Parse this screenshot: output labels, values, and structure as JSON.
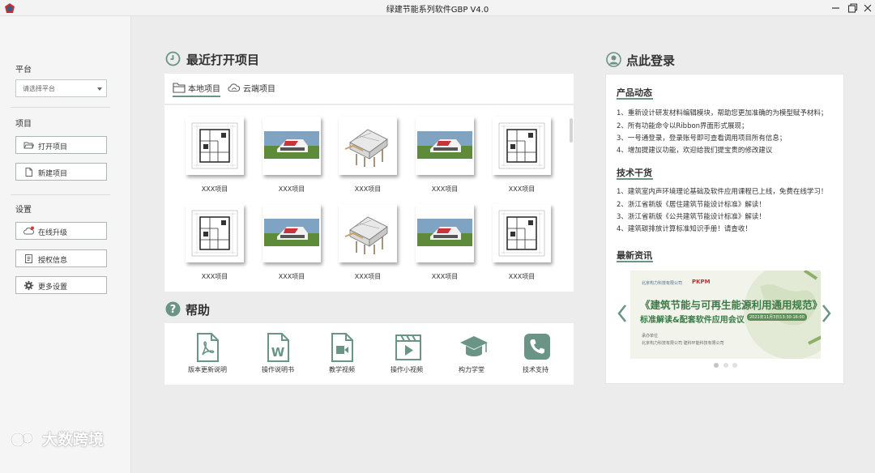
{
  "window": {
    "title": "绿建节能系列软件GBP   V4.0"
  },
  "sidebar": {
    "platform_title": "平台",
    "platform_placeholder": "请选择平台",
    "project_title": "项目",
    "open_project": "打开项目",
    "new_project": "新建项目",
    "settings_title": "设置",
    "online_upgrade": "在线升级",
    "license_info": "授权信息",
    "more_settings": "更多设置"
  },
  "watermark": "大数跨境",
  "recent": {
    "heading": "最近打开项目",
    "tabs": [
      "本地项目",
      "云端项目"
    ],
    "projects": [
      {
        "label": "XXX项目",
        "thumb": "floorplan"
      },
      {
        "label": "XXX项目",
        "thumb": "render"
      },
      {
        "label": "XXX项目",
        "thumb": "model"
      },
      {
        "label": "XXX项目",
        "thumb": "render"
      },
      {
        "label": "XXX项目",
        "thumb": "floorplan"
      },
      {
        "label": "XXX项目",
        "thumb": "floorplan"
      },
      {
        "label": "XXX项目",
        "thumb": "render"
      },
      {
        "label": "XXX项目",
        "thumb": "model"
      },
      {
        "label": "XXX项目",
        "thumb": "render"
      },
      {
        "label": "XXX项目",
        "thumb": "floorplan"
      }
    ]
  },
  "help": {
    "heading": "帮助",
    "items": [
      {
        "label": "版本更新说明",
        "icon": "pdf-icon"
      },
      {
        "label": "操作说明书",
        "icon": "word-icon"
      },
      {
        "label": "教学视频",
        "icon": "video-icon"
      },
      {
        "label": "操作小视频",
        "icon": "clapper-icon"
      },
      {
        "label": "构力学堂",
        "icon": "graduation-cap-icon"
      },
      {
        "label": "技术支持",
        "icon": "phone-icon"
      }
    ]
  },
  "account": {
    "heading": "点此登录"
  },
  "news": {
    "product_title": "产品动态",
    "product_items": [
      "1、重新设计研发材料编辑模块，帮助您更加准确的为模型赋予材料；",
      "2、所有功能命令以Ribbon界面形式展现；",
      "3、一号通登录，登录账号即可查看调用项目所有信息；",
      "4、增加提建议功能，欢迎给我们提宝贵的修改建议"
    ],
    "tech_title": "技术干货",
    "tech_items": [
      "1、建筑室内声环境理论基础及软件应用课程已上线，免费在线学习！",
      "2、浙江省新版《居住建筑节能设计标准》解读！",
      "3、浙江省新版《公共建筑节能设计标准》解读！",
      "4、建筑碳排放计算标准知识手册！请查收！"
    ],
    "latest_title": "最新资讯"
  },
  "banner": {
    "logo_left": "北京构力科技有限公司",
    "logo_right": "PKPM",
    "title": "《建筑节能与可再生能源利用通用规范》",
    "subtitle": "标准解读&配套软件应用会议",
    "date": "2021年11月3日13:30-16:00",
    "org_label": "承办单位",
    "orgs": "北京构力科技有限公司  建科环能科技有限公司"
  },
  "colors": {
    "accent": "#6a9485",
    "banner_green": "#3b7a46"
  }
}
